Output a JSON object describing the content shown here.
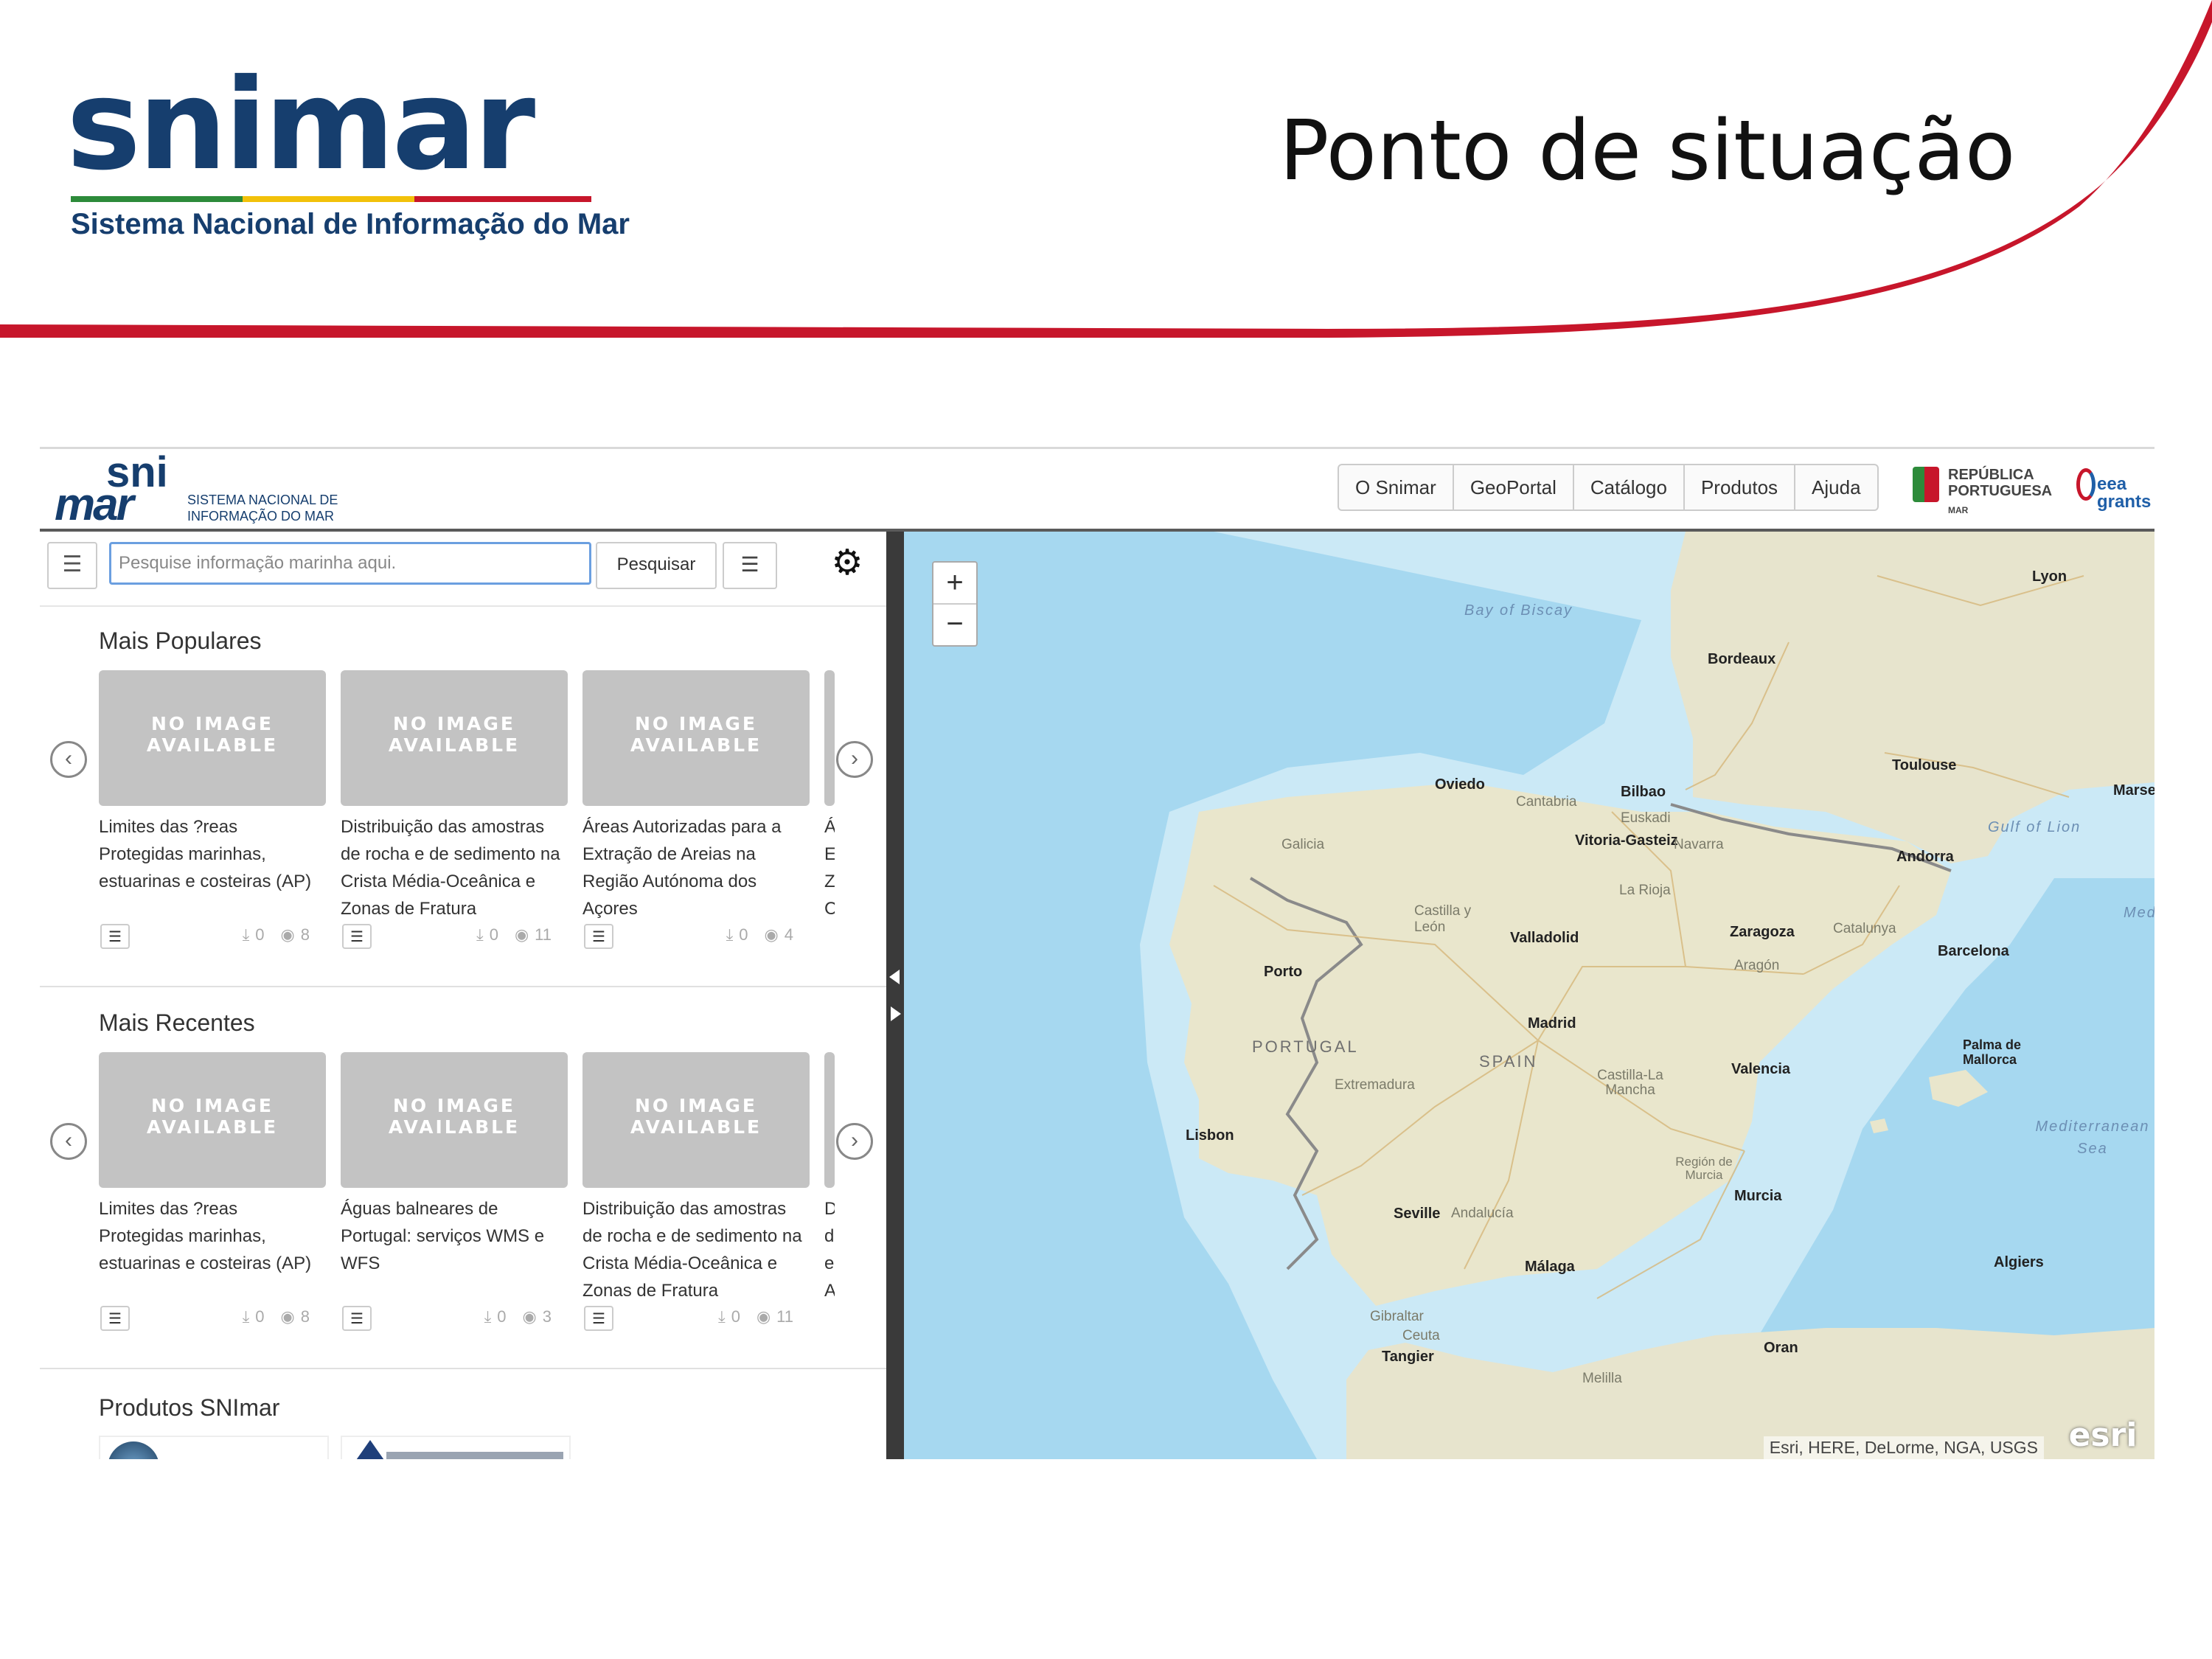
{
  "slide": {
    "title": "Ponto de situação",
    "logo_text": "snimar",
    "logo_tagline": "Sistema Nacional de Informação do Mar",
    "accent_color": "#c7162b",
    "brand_color": "#163e6e"
  },
  "app": {
    "logo": {
      "sni": "sni",
      "mar": "mar",
      "subtitle": "SISTEMA NACIONAL DE INFORMAÇÃO DO MAR"
    },
    "nav": [
      "O Snimar",
      "GeoPortal",
      "Catálogo",
      "Produtos",
      "Ajuda"
    ],
    "partner_logo_republica": "REPÚBLICA PORTUGUESA",
    "partner_logo_republica_sub": "MAR",
    "partner_logo_eea": "eea grants",
    "search": {
      "placeholder": "Pesquise informação marinha aqui.",
      "button": "Pesquisar"
    },
    "icons": {
      "menu": "menu-icon",
      "filter": "sliders-icon",
      "settings": "gear-icon"
    },
    "sections": [
      {
        "title": "Mais Populares",
        "cards": [
          {
            "thumb_text": "NO IMAGE AVAILABLE",
            "title": "Limites das ?reas Protegidas marinhas, estuarinas e costeiras (AP)",
            "downloads": "0",
            "views": "8"
          },
          {
            "thumb_text": "NO IMAGE AVAILABLE",
            "title": "Distribuição das amostras de rocha e de sedimento na Crista Média-Oceânica e Zonas de Fratura",
            "downloads": "0",
            "views": "11"
          },
          {
            "thumb_text": "NO IMAGE AVAILABLE",
            "title": "Áreas Autorizadas para a Extração de Areias na Região Autónoma dos Açores",
            "downloads": "0",
            "views": "4"
          }
        ],
        "partial_text": "Á E Z C"
      },
      {
        "title": "Mais Recentes",
        "cards": [
          {
            "thumb_text": "NO IMAGE AVAILABLE",
            "title": "Limites das ?reas Protegidas marinhas, estuarinas e costeiras (AP)",
            "downloads": "0",
            "views": "8"
          },
          {
            "thumb_text": "NO IMAGE AVAILABLE",
            "title": "Águas balneares de Portugal: serviços WMS e WFS",
            "downloads": "0",
            "views": "3"
          },
          {
            "thumb_text": "NO IMAGE AVAILABLE",
            "title": "Distribuição das amostras de rocha e de sedimento na Crista Média-Oceânica e Zonas de Fratura",
            "downloads": "0",
            "views": "11"
          }
        ],
        "partial_text": "D d e A"
      },
      {
        "title": "Produtos SNImar"
      }
    ]
  },
  "map": {
    "zoom_in": "+",
    "zoom_out": "−",
    "attribution": "Esri, HERE, DeLorme, NGA, USGS",
    "esri_logo": "esri",
    "labels": {
      "bay_of_biscay": "Bay of Biscay",
      "lyon": "Lyon",
      "bordeaux": "Bordeaux",
      "toulouse": "Toulouse",
      "marseille": "Marseil",
      "gulf_of_lion": "Gulf of Lion",
      "oviedo": "Oviedo",
      "cantabria": "Cantabria",
      "bilbao": "Bilbao",
      "euskadi": "Euskadi",
      "vitoria": "Vitoria-Gasteiz",
      "navarra": "Navarra",
      "andorra": "Andorra",
      "galicia": "Galicia",
      "la_rioja": "La Rioja",
      "castilla_leon": "Castilla y León",
      "valladolid": "Valladolid",
      "zaragoza": "Zaragoza",
      "catalunya": "Catalunya",
      "aragon": "Aragón",
      "barcelona": "Barcelona",
      "porto": "Porto",
      "madrid": "Madrid",
      "portugal": "PORTUGAL",
      "spain": "SPAIN",
      "extremadura": "Extremadura",
      "castilla_mancha": "Castilla-La Mancha",
      "valencia": "Valencia",
      "palma": "Palma de Mallorca",
      "mediterranean_sea": "Mediterranean Sea",
      "mediter": "Mediter",
      "lisbon": "Lisbon",
      "murcia_region": "Región de Murcia",
      "murcia": "Murcia",
      "seville": "Seville",
      "andalucia": "Andalucía",
      "malaga": "Málaga",
      "algiers": "Algiers",
      "gibraltar": "Gibraltar",
      "ceuta": "Ceuta",
      "tangier": "Tangier",
      "oran": "Oran",
      "melilla": "Melilla"
    }
  }
}
